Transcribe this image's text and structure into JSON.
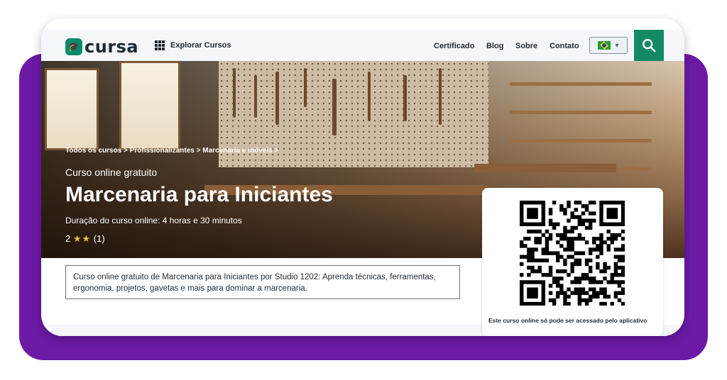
{
  "brand": {
    "logo_text": "cursa",
    "color": "#138a63"
  },
  "header": {
    "explore_label": "Explorar Cursos",
    "nav": [
      "Certificado",
      "Blog",
      "Sobre",
      "Contato"
    ],
    "language_icon": "brazil-flag-icon",
    "search_icon": "search-icon"
  },
  "hero": {
    "breadcrumbs": [
      "Todos os cursos",
      "Profissionalizantes",
      "Marcenaria e móveis"
    ],
    "tagline": "Curso online gratuito",
    "title": "Marcenaria para Iniciantes",
    "duration": "Duração do curso online: 4 horas e 30 minutos",
    "rating_value": "2",
    "stars_text": "★★",
    "rating_count": "(1)"
  },
  "description": "Curso online gratuito de Marcenaria para Iniciantes por Studio 1202: Aprenda técnicas, ferramentas, ergonomia, projetos, gavetas e mais para dominar a marcenaria.",
  "qr": {
    "caption": "Este curso online só pode ser acessado pelo aplicativo"
  },
  "colors": {
    "accent": "#138a63",
    "frame_purple": "#6c1aa6",
    "star": "#f1c232"
  }
}
